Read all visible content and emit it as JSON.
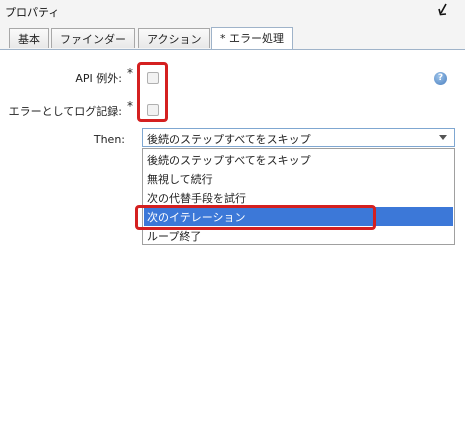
{
  "panel": {
    "title": "プロパティ"
  },
  "tabs": [
    {
      "label": "基本"
    },
    {
      "label": "ファインダー"
    },
    {
      "label": "アクション"
    },
    {
      "label": "* エラー処理"
    }
  ],
  "form": {
    "api_exception_label": "API 例外:",
    "log_as_error_label": "エラーとしてログ記録:",
    "required_mark": "*",
    "then_label": "Then:",
    "then_value": "後続のステップすべてをスキップ",
    "options": [
      "後続のステップすべてをスキップ",
      "無視して続行",
      "次の代替手段を試行",
      "次のイテレーション",
      "ループ終了"
    ],
    "highlighted_index": 3
  },
  "icons": {
    "collapse": "collapse-arrow-icon",
    "help": "help-icon"
  },
  "colors": {
    "annotation": "#d42020",
    "selection": "#3c78d8"
  }
}
